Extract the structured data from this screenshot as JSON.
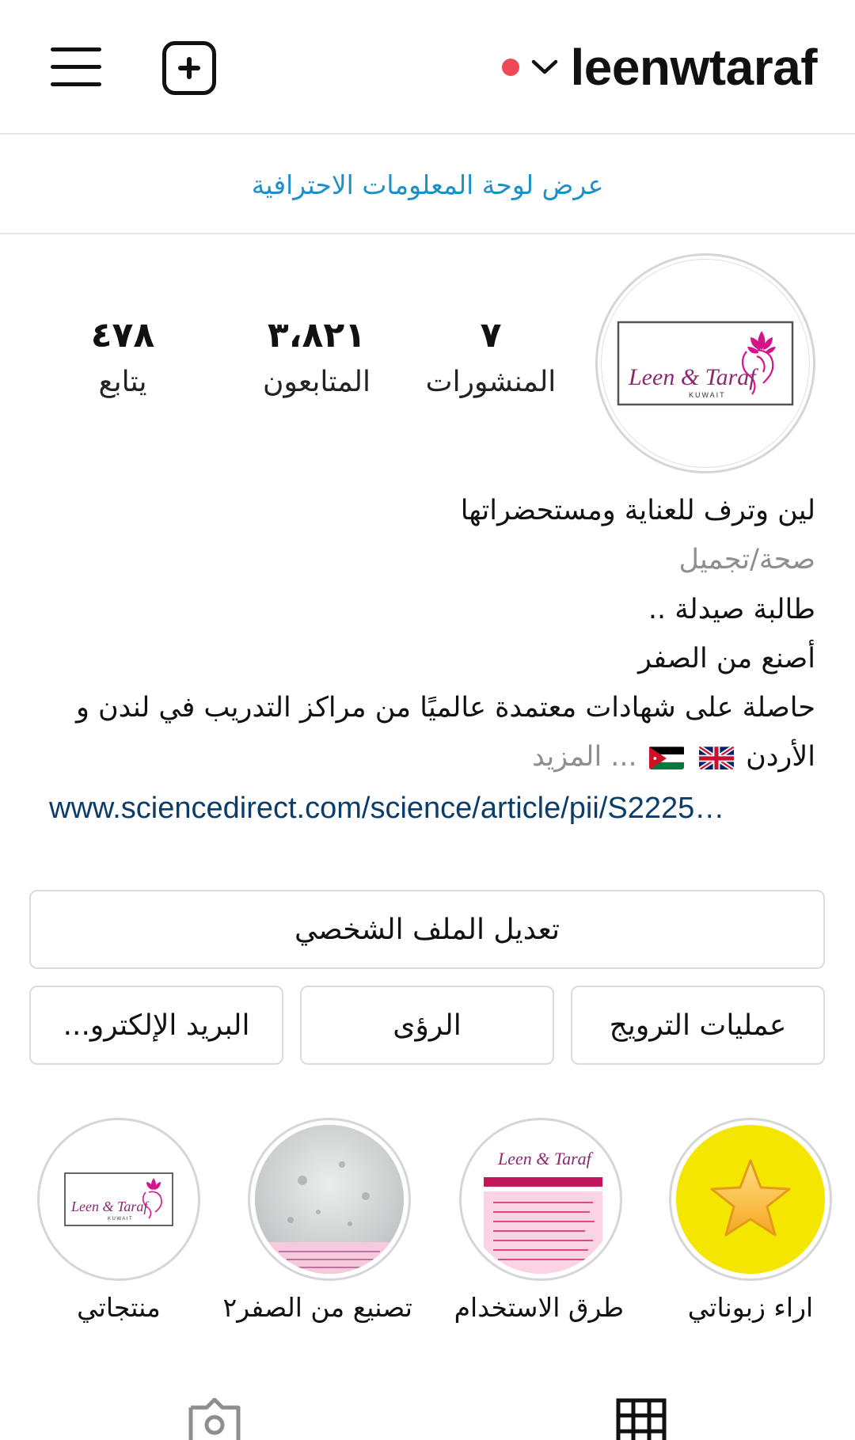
{
  "header": {
    "username": "leenwtaraf"
  },
  "pro_dashboard_link": "عرض لوحة المعلومات الاحترافية",
  "stats": [
    {
      "value": "٧",
      "label": "المنشورات"
    },
    {
      "value": "٣،٨٢١",
      "label": "المتابعون"
    },
    {
      "value": "٤٧٨",
      "label": "يتابع"
    }
  ],
  "avatar": {
    "logo_text": "Leen & Taraf",
    "logo_subtext": "KUWAIT"
  },
  "bio": {
    "name": "لين وترف للعناية ومستحضراتها",
    "category": "صحة/تجميل",
    "lines": [
      "طالبة صيدلة ..",
      "أصنع من الصفر",
      "حاصلة على شهادات معتمدة عالميًا من مراكز التدريب في لندن و"
    ],
    "last_line_text": "الأردن",
    "more": "... المزيد",
    "link": "www.sciencedirect.com/science/article/pii/S2225…"
  },
  "buttons": {
    "edit_profile": "تعديل الملف الشخصي",
    "promotions": "عمليات الترويج",
    "insights": "الرؤى",
    "email": "البريد الإلكترو..."
  },
  "highlights": [
    {
      "label": "اراء زبوناتي",
      "kind": "star"
    },
    {
      "label": "طرق الاستخدام",
      "kind": "card"
    },
    {
      "label": "تصنيع من الصفر٢",
      "kind": "photo"
    },
    {
      "label": "منتجاتي",
      "kind": "logo"
    }
  ],
  "colors": {
    "link_blue": "#1e90c8",
    "url_navy": "#0b3d6b",
    "notif_red": "#ed4956",
    "brand_pink": "#d4148a"
  }
}
